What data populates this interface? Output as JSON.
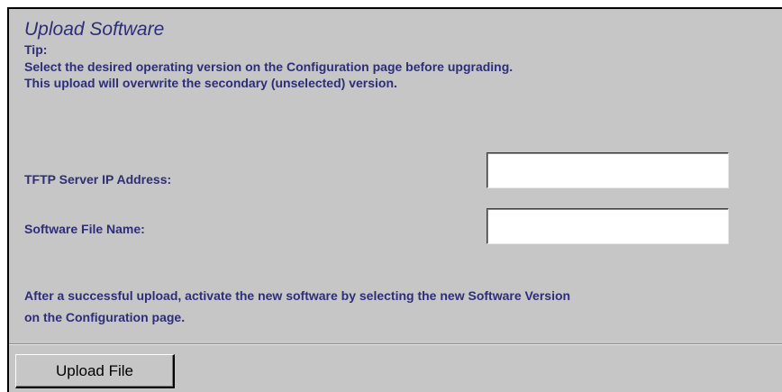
{
  "panel": {
    "title": "Upload Software",
    "tip_heading": "Tip:",
    "tip_lines": [
      "Select the desired operating version on the Configuration page before upgrading.",
      "This upload will overwrite the secondary (unselected) version."
    ]
  },
  "form": {
    "tftp_ip_label": "TFTP Server IP Address:",
    "tftp_ip_value": "",
    "file_name_label": "Software File Name:",
    "file_name_value": ""
  },
  "after_note": {
    "lines": [
      "After a successful upload, activate the new software by selecting the new Software Version",
      "on the Configuration page."
    ]
  },
  "actions": {
    "upload_label": "Upload File"
  },
  "colors": {
    "panel_background": "#c6c6c6",
    "label_text": "#2e2e78",
    "input_background": "#ffffff"
  }
}
